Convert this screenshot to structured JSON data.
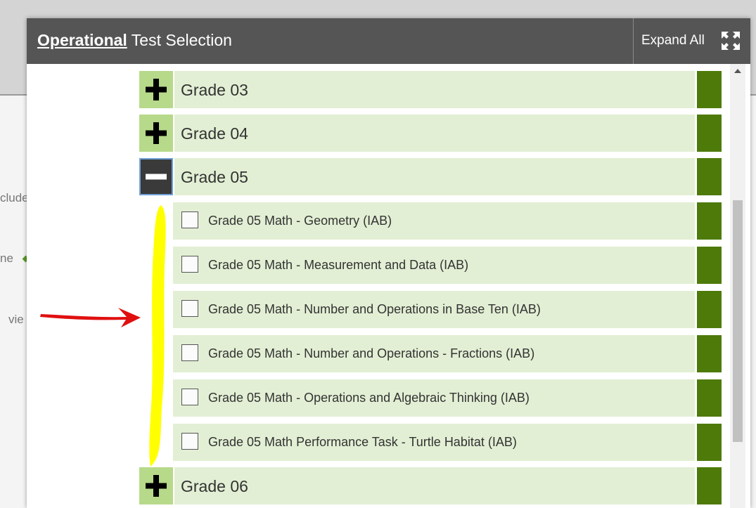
{
  "background": {
    "fragments": [
      "clude",
      "ne",
      "vie"
    ]
  },
  "modal": {
    "title_bold": "Operational",
    "title_rest": " Test Selection",
    "expand_label": "Expand All",
    "expand_icon": "expand-arrows-icon"
  },
  "grades_before": [
    {
      "label": "Grade 03",
      "state": "collapsed"
    },
    {
      "label": "Grade 04",
      "state": "collapsed"
    }
  ],
  "grade_open": {
    "label": "Grade 05",
    "state": "expanded"
  },
  "tests": [
    {
      "label": "Grade 05 Math - Geometry (IAB)",
      "checked": false
    },
    {
      "label": "Grade 05 Math - Measurement and Data (IAB)",
      "checked": false
    },
    {
      "label": "Grade 05 Math - Number and Operations in Base Ten (IAB)",
      "checked": false
    },
    {
      "label": "Grade 05 Math - Number and Operations - Fractions (IAB)",
      "checked": false
    },
    {
      "label": "Grade 05 Math - Operations and Algebraic Thinking (IAB)",
      "checked": false
    },
    {
      "label": "Grade 05 Math Performance Task - Turtle Habitat (IAB)",
      "checked": false
    }
  ],
  "grades_after": [
    {
      "label": "Grade 06",
      "state": "collapsed"
    }
  ],
  "colors": {
    "header": "#555555",
    "row_bg": "#e2efd4",
    "toggle_bg": "#b7d98a",
    "row_end": "#4e7a0a",
    "highlight": "#ffff00",
    "arrow": "#e01010"
  }
}
